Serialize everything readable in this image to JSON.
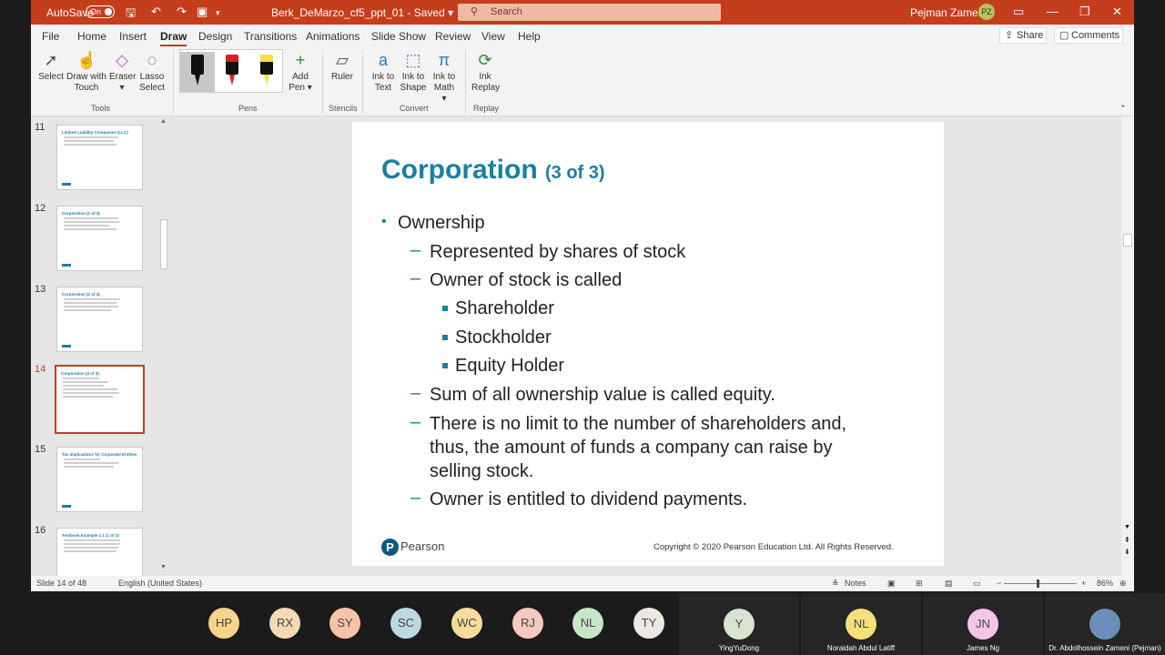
{
  "titlebar": {
    "autosave_label": "AutoSave",
    "autosave_state": "On",
    "doc_title": "Berk_DeMarzo_cf5_ppt_01  -  Saved  ▾",
    "search_placeholder": "Search",
    "user_name": "Pejman Zameni",
    "user_initials": "PZ"
  },
  "tabs": [
    "File",
    "Home",
    "Insert",
    "Draw",
    "Design",
    "Transitions",
    "Animations",
    "Slide Show",
    "Review",
    "View",
    "Help"
  ],
  "active_tab": "Draw",
  "share_label": "Share",
  "comments_label": "Comments",
  "ribbon": {
    "tools": [
      {
        "l1": "Select",
        "l2": ""
      },
      {
        "l1": "Draw with",
        "l2": "Touch"
      },
      {
        "l1": "Eraser",
        "l2": "▾"
      },
      {
        "l1": "Lasso",
        "l2": "Select"
      }
    ],
    "tools_group": "Tools",
    "pens_group": "Pens",
    "add_pen": {
      "l1": "Add",
      "l2": "Pen ▾"
    },
    "ruler": "Ruler",
    "stencils_group": "Stencils",
    "convert": [
      {
        "l1": "Ink to",
        "l2": "Text"
      },
      {
        "l1": "Ink to",
        "l2": "Shape"
      },
      {
        "l1": "Ink to",
        "l2": "Math ▾"
      }
    ],
    "convert_group": "Convert",
    "replay": {
      "l1": "Ink",
      "l2": "Replay"
    },
    "replay_group": "Replay",
    "pen_colors": [
      "#111111",
      "#e01b24",
      "#f5e23a"
    ]
  },
  "thumbnails": [
    {
      "num": "11",
      "title": "Limited Liability Companies (LLC)"
    },
    {
      "num": "12",
      "title": "Corporation (1 of 3)"
    },
    {
      "num": "13",
      "title": "Corporation (2 of 3)"
    },
    {
      "num": "14",
      "title": "Corporation (3 of 3)"
    },
    {
      "num": "15",
      "title": "Tax Implications for Corporate Entities"
    },
    {
      "num": "16",
      "title": "Textbook Example 1.1 (1 of 2)"
    }
  ],
  "slide": {
    "title_main": "Corporation",
    "title_sub": "(3 of 3)",
    "bullets": {
      "b1": "Ownership",
      "d1": "Represented by shares of stock",
      "d2": "Owner of stock is called",
      "s1": "Shareholder",
      "s2": "Stockholder",
      "s3": "Equity Holder",
      "d3": "Sum of all ownership value is called equity.",
      "d4a": "There is no limit to the number of shareholders and,",
      "d4b": "thus, the amount of funds a company can raise by",
      "d4c": "selling stock.",
      "d5": "Owner is entitled to dividend payments."
    },
    "pearson": "Pearson",
    "copyright": "Copyright © 2020 Pearson Education Ltd. All Rights Reserved."
  },
  "status": {
    "slide_of": "Slide 14 of 48",
    "language": "English (United States)",
    "notes": "Notes",
    "zoom": "86%"
  },
  "participants": [
    {
      "initials": "HP",
      "color": "#f5d58a"
    },
    {
      "initials": "RX",
      "color": "#f5d9b5"
    },
    {
      "initials": "SY",
      "color": "#f5c4a8"
    },
    {
      "initials": "SC",
      "color": "#bcd8e0"
    },
    {
      "initials": "WC",
      "color": "#f5dc9a"
    },
    {
      "initials": "RJ",
      "color": "#f5c9c0"
    },
    {
      "initials": "NL",
      "color": "#c7e6c8"
    },
    {
      "initials": "TY",
      "color": "#ece9e2"
    }
  ],
  "tiles": [
    {
      "initials": "Y",
      "name": "YingYuDong",
      "color": "#d8e4d0"
    },
    {
      "initials": "NL",
      "name": "Noraidah Abdul Latiff",
      "color": "#f5e07a"
    },
    {
      "initials": "JN",
      "name": "James Ng",
      "color": "#f3c6e6"
    },
    {
      "initials": "",
      "name": "Dr. Abdolhossein Zameni (Pejman)",
      "color": "#6b8fb8"
    }
  ]
}
